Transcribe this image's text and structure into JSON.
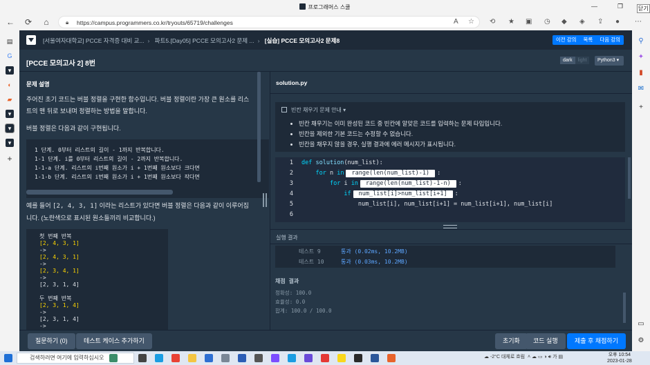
{
  "browser": {
    "window_title": "프로그래머스 스쿨",
    "url": "https://campus.programmers.co.kr/tryouts/65719/challenges",
    "close_label": "닫기"
  },
  "header": {
    "breadcrumb": [
      "[서울여자대학교] PCCE 자격증 대비 교...",
      "파트5.[Day05] PCCE 모의고사2 문제 ...",
      "[실습] PCCE 모의고사2 문제8"
    ],
    "buttons": [
      "이전 강의",
      "목록",
      "다음 강의"
    ],
    "accent": "#0078ff"
  },
  "subheader": {
    "title": "[PCCE 모의고사 2] 8번",
    "theme_dark": "dark",
    "theme_light": "light",
    "language": "Python3"
  },
  "problem": {
    "section_title": "문제 설명",
    "p1": "주어진 초기 코드는 버블 정렬을 구현한 함수입니다. 버블 정렬이란 가장 큰 원소를 리스트의 맨 뒤로 보내며 정렬하는 방법을 말합니다.",
    "p2": "버블 정렬은 다음과 같이 구현됩니다.",
    "code_lines": [
      "1 단계. 0부터 리스트의 길이 - 1까지 반복합니다.",
      "   1-1 단계. i를 0부터 리스트의 길이 - 2까지 반복합니다.",
      "      1-1-a 단계. 리스트의 i번째 원소가 i + 1번째 원소보다 크다면",
      "      1-1-b 단계. 리스트의 i번째 원소가 i + 1번째 원소보다 작다면"
    ],
    "p3_pre": "예를 들어 ",
    "p3_code": "[2, 4, 3, 1]",
    "p3_post": " 이라는 리스트가 있다면 버블 정렬은 다음과 같이 이루어집니다. (노란색으로 표시된 원소들끼리 비교합니다.)",
    "example_lines": [
      {
        "t": "첫 번째 반복",
        "h": ""
      },
      {
        "t": "",
        "h": "[2, 4, 3, 1]"
      },
      {
        "t": "->",
        "h": ""
      },
      {
        "t": "",
        "h": "[2, 4, 3, 1]"
      },
      {
        "t": "->",
        "h": ""
      },
      {
        "t": "",
        "h": "[2, 3, 4, 1]"
      },
      {
        "t": "->",
        "h": ""
      },
      {
        "t": "[2, 3, 1, 4]",
        "h": ""
      },
      {
        "t": "",
        "h": ""
      },
      {
        "t": "두 번째 반복",
        "h": ""
      },
      {
        "t": "",
        "h": "[2, 3, 1, 4]"
      },
      {
        "t": "->",
        "h": ""
      },
      {
        "t": "[2, 3, 1, 4]",
        "h": ""
      },
      {
        "t": "->",
        "h": ""
      }
    ]
  },
  "editor": {
    "filename": "solution.py",
    "guide_title": "빈칸 채우기 문제 안내",
    "guide_items": [
      "빈칸 채우기는 이미 완성된 코드 중 빈칸에 알맞은 코드를 입력하는 문제 타입입니다.",
      "빈칸을 제외한 기본 코드는 수정할 수 없습니다.",
      "빈칸을 채우지 않을 경우, 실행 결과에 에러 메시지가 표시됩니다."
    ],
    "line_numbers": [
      "1",
      "2",
      "3",
      "4",
      "5",
      "6"
    ],
    "l1_kw": "def",
    "l1_fn": "solution",
    "l1_rest": "(num_list):",
    "l2_kw1": "for",
    "l2_var": "n",
    "l2_kw2": "in",
    "l2_blank": "range(len(num_list)-1)",
    "l2_end": ":",
    "l3_kw1": "for",
    "l3_var": "i",
    "l3_kw2": "in",
    "l3_blank": "range(len(num_list)-1-n)",
    "l3_end": ":",
    "l4_kw": "if",
    "l4_blank": "num_list[i]>num_list[i+1]",
    "l4_end": ":",
    "l5": "num_list[i], num_list[i+1] = num_list[i+1], num_list[i]"
  },
  "results": {
    "header": "실행 결과",
    "rows": [
      {
        "name": "테스트 9",
        "value": "통과 (0.02ms, 10.2MB)"
      },
      {
        "name": "테스트 10",
        "value": "통과 (0.03ms, 10.2MB)"
      }
    ],
    "score_title": "채점 결과",
    "score_lines": [
      "정확성: 100.0",
      "합계: 100.0 / 100.0"
    ],
    "score_mid": "효율성: 0.0"
  },
  "footer": {
    "ask": "질문하기 (0)",
    "add_test": "테스트 케이스 추가하기",
    "reset": "초기화",
    "run": "코드 실행",
    "submit": "제출 후 채점하기"
  },
  "taskbar": {
    "search_placeholder": "검색하려면 여기에 입력하십시오",
    "weather": "-2°C 대체로 흐림",
    "time": "오후 10:54",
    "date": "2023-01-28"
  }
}
